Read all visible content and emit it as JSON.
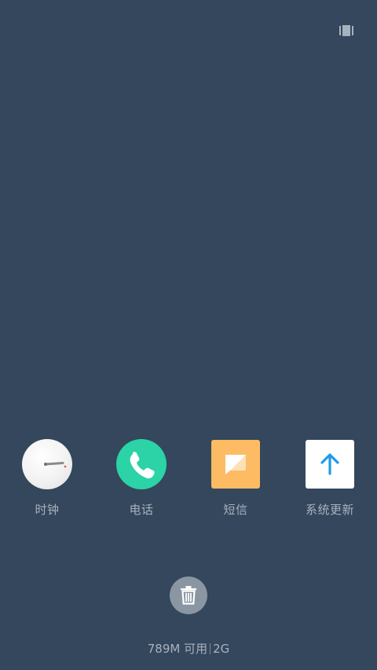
{
  "apps": [
    {
      "label": "时钟",
      "icon": "clock-icon"
    },
    {
      "label": "电话",
      "icon": "phone-icon"
    },
    {
      "label": "短信",
      "icon": "message-icon"
    },
    {
      "label": "系统更新",
      "icon": "system-update-icon"
    }
  ],
  "memory": {
    "available": "789M 可用",
    "total": "2G"
  },
  "colors": {
    "background": "#34475c",
    "phone": "#2bd3a6",
    "sms": "#fdbb64",
    "update_arrow": "#1e9be9",
    "label": "#a8b2bf"
  }
}
